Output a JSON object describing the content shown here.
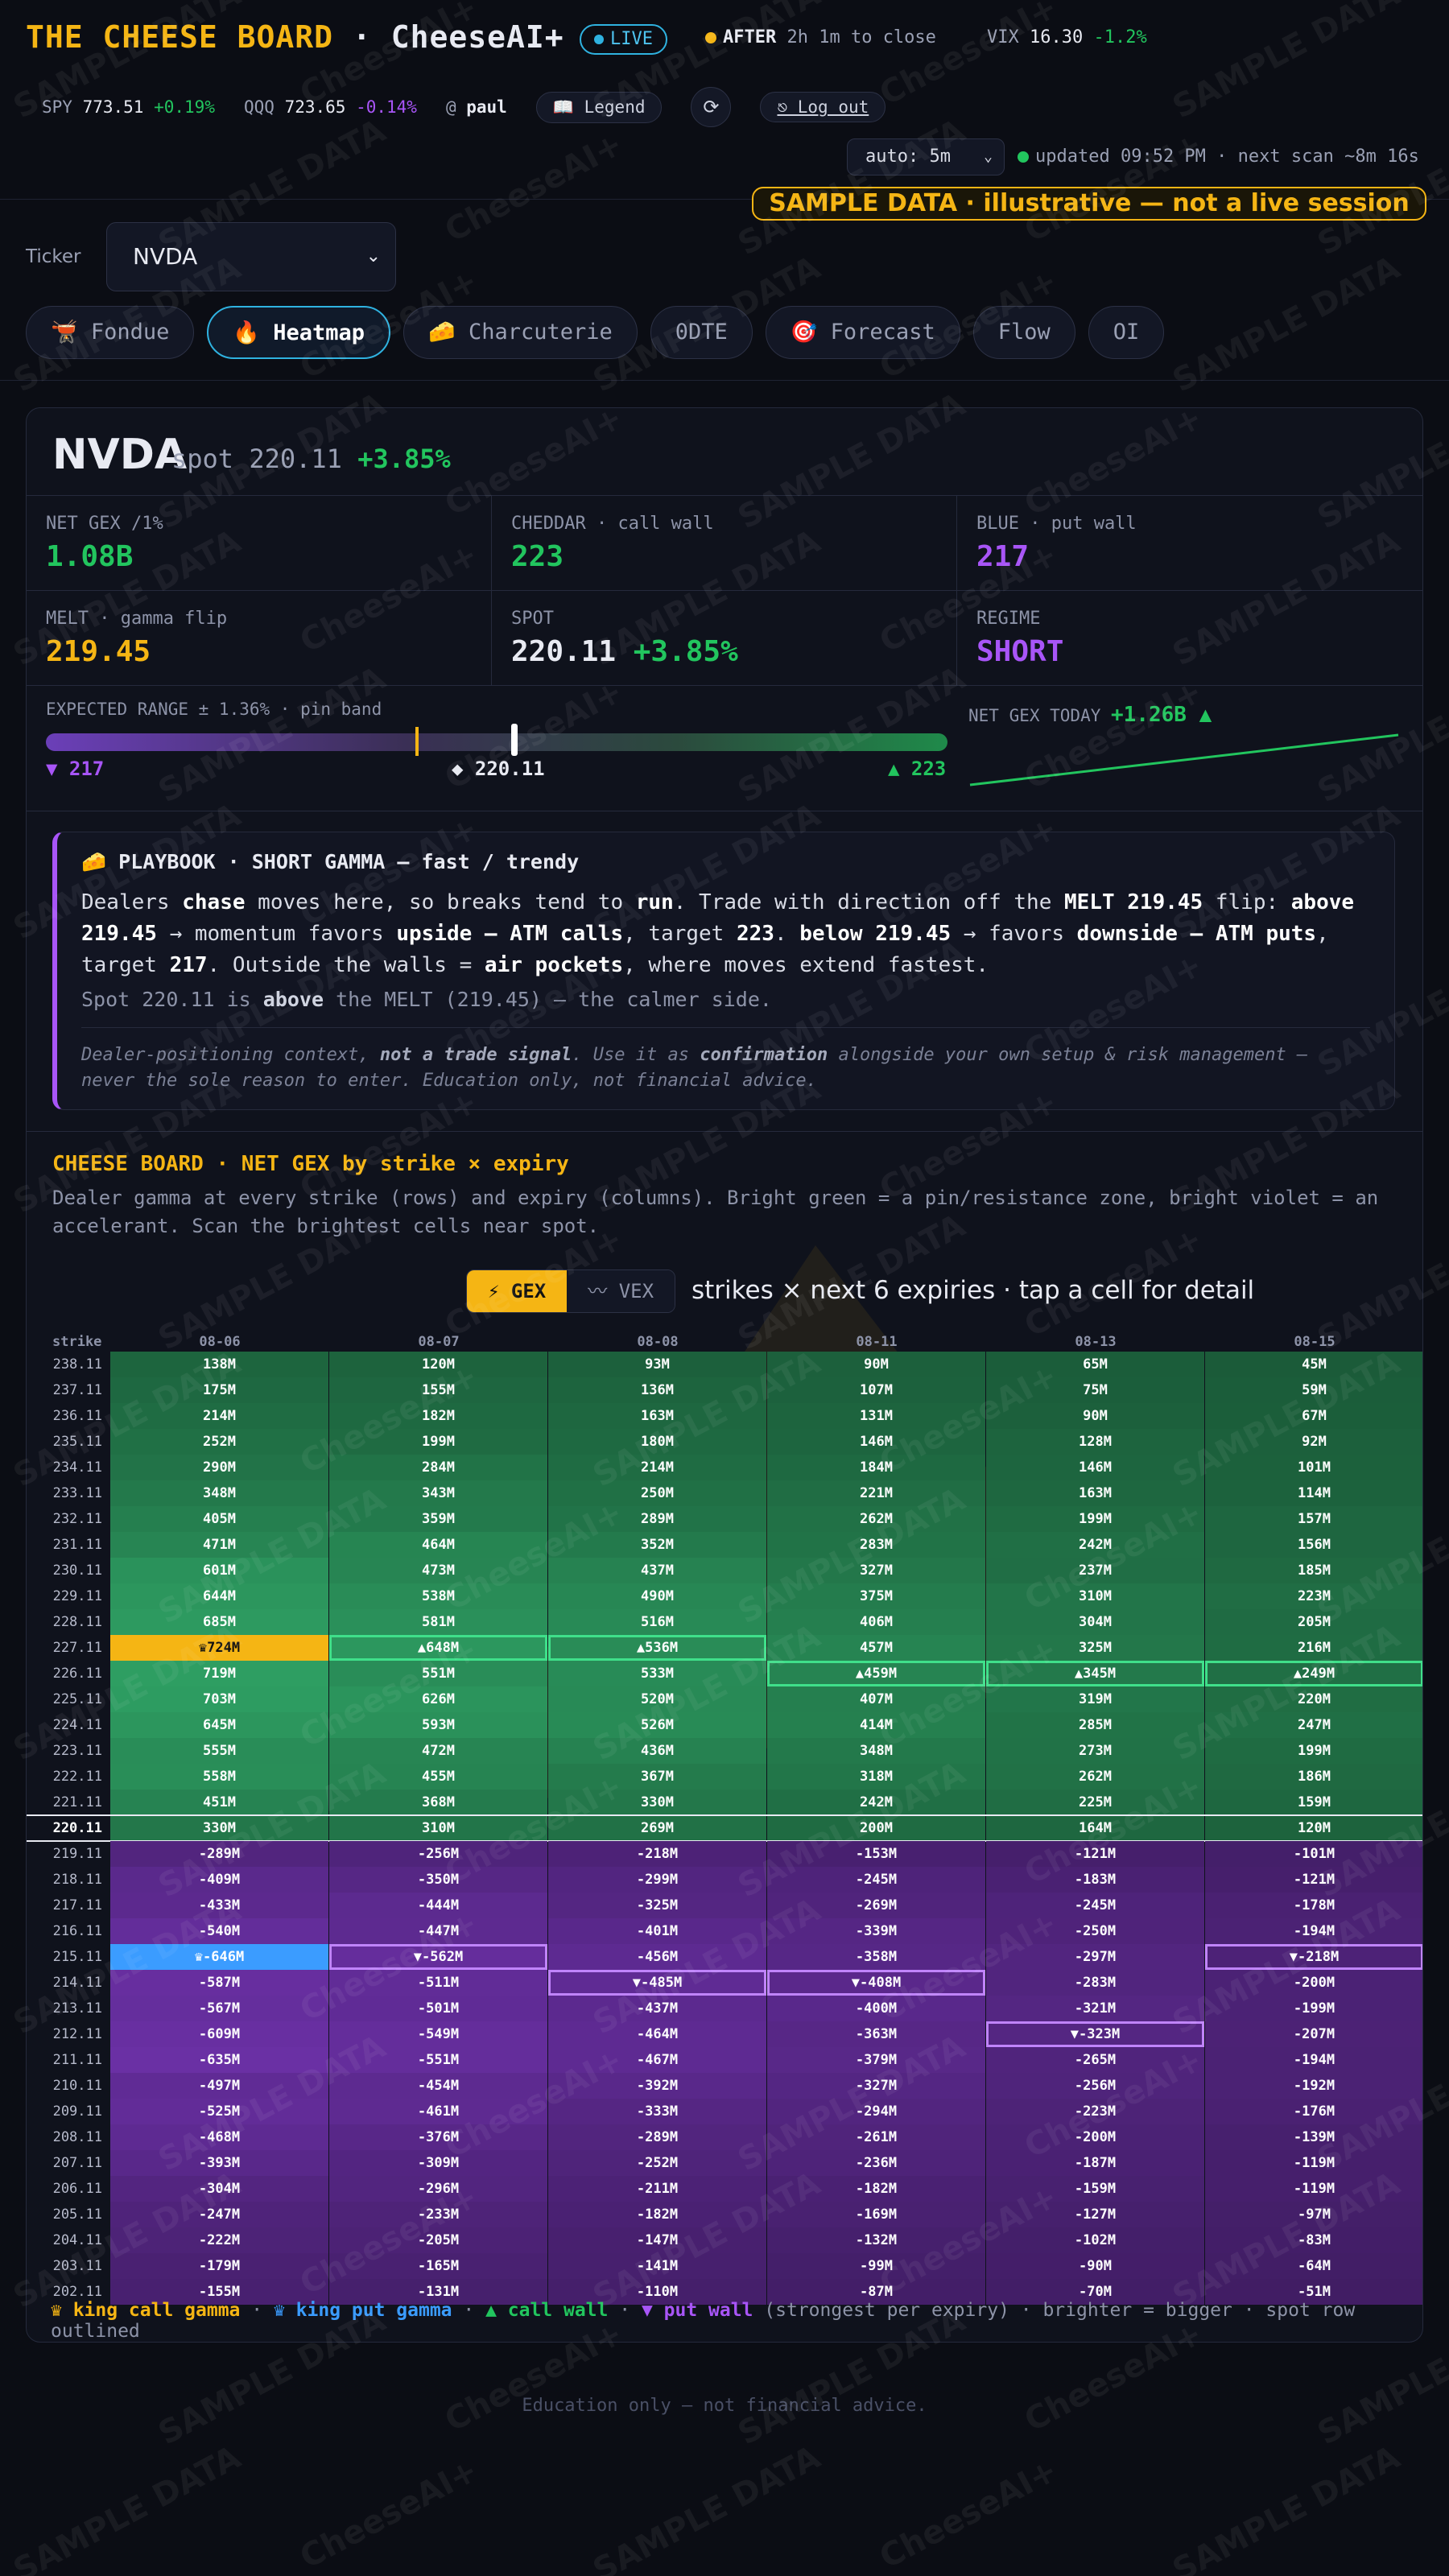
{
  "header": {
    "brand": "THE CHEESE BOARD",
    "brand_sep": " · ",
    "brand_product": "CheeseAI+",
    "live_label": "LIVE",
    "after_label": "AFTER",
    "after_text": "2h 1m to close",
    "vix_label": "VIX",
    "vix_value": "16.30",
    "vix_change": "-1.2%",
    "spy_label": "SPY",
    "spy_value": "773.51",
    "spy_change": "+0.19%",
    "qqq_label": "QQQ",
    "qqq_value": "723.65",
    "qqq_change": "-0.14%",
    "user_prefix": "@",
    "user_name": "paul",
    "legend_button": "📖 Legend",
    "refresh_icon": "⟳",
    "logout_button": "⎋ Log out",
    "auto_select": "auto: 5m",
    "updated_text": "updated 09:52 PM · next scan ~8m 16s",
    "sample_banner": "SAMPLE DATA · illustrative — not a live session"
  },
  "ticker": {
    "label": "Ticker",
    "value": "NVDA"
  },
  "tabs": [
    {
      "label": "🫕 Fondue"
    },
    {
      "label": "🔥 Heatmap"
    },
    {
      "label": "🧀 Charcuterie"
    },
    {
      "label": "0DTE"
    },
    {
      "label": "🎯 Forecast"
    },
    {
      "label": "Flow"
    },
    {
      "label": "OI"
    }
  ],
  "summary": {
    "symbol": "NVDA",
    "spot_label": "spot",
    "spot": "220.11",
    "spot_change": "+3.85%",
    "cells": [
      {
        "label": "NET GEX /1%",
        "value": "1.08B",
        "color": "#22c55e"
      },
      {
        "label": "CHEDDAR · call wall",
        "value": "223",
        "color": "#22c55e"
      },
      {
        "label": "BLUE · put wall",
        "value": "217",
        "color": "#a855f7"
      },
      {
        "label": "MELT · gamma flip",
        "value": "219.45",
        "color": "#f5b514"
      },
      {
        "label": "SPOT",
        "value": "220.11",
        "value2": "+3.85%",
        "color": "#e8eaf2"
      },
      {
        "label": "REGIME",
        "value": "SHORT",
        "color": "#a855f7"
      }
    ],
    "range_label": "EXPECTED RANGE ± 1.36% · pin band",
    "range_low": "▼ 217",
    "range_mid": "◆ 220.11",
    "range_high": "▲ 223",
    "range_pin_frac": 0.41,
    "range_spot_frac": 0.52,
    "netgex_today_label": "NET GEX TODAY",
    "netgex_today_value": "+1.26B ▲"
  },
  "playbook": {
    "title": "🧀 PLAYBOOK · SHORT GAMMA — fast / trendy",
    "line1_a": "Dealers ",
    "line1_b": "chase",
    "line1_c": " moves here, so breaks tend to ",
    "line1_d": "run",
    "line1_e": ". Trade with direction off the ",
    "line1_f": "MELT 219.45",
    "line1_g": " flip: ",
    "line1_h": "above 219.45",
    "line1_i": " → momentum favors ",
    "line1_j": "upside — ATM calls",
    "line1_k": ", target ",
    "line1_l": "223",
    "line1_m": ". ",
    "line1_n": "below 219.45",
    "line1_o": " → favors ",
    "line1_p": "downside — ATM puts",
    "line1_q": ", target ",
    "line1_r": "217",
    "line1_s": ". Outside the walls = ",
    "line1_t": "air pockets",
    "line1_u": ", where moves extend fastest.",
    "note_a": "Spot 220.11 is ",
    "note_b": "above",
    "note_c": " the MELT (219.45) — the calmer side.",
    "disc_a": "Dealer-positioning context, ",
    "disc_b": "not a trade signal",
    "disc_c": ". Use it as ",
    "disc_d": "confirmation",
    "disc_e": " alongside your own setup & risk management — never the sole reason to enter. Education only, not financial advice."
  },
  "heatmap": {
    "title": "CHEESE BOARD · NET GEX by strike × expiry",
    "description": "Dealer gamma at every strike (rows) and expiry (columns). Bright green = a pin/resistance zone, bright violet = an accelerant. Scan the brightest cells near spot.",
    "toggle_gex": "⚡ GEX",
    "toggle_vex": "〰 VEX",
    "caption": "strikes × next 6 expiries · tap a cell for detail",
    "strike_header": "strike",
    "expiries": [
      "08-06",
      "08-07",
      "08-08",
      "08-11",
      "08-13",
      "08-15"
    ],
    "spot_strike": "220.11",
    "rows": [
      {
        "strike": "238.11",
        "values": [
          138,
          120,
          93,
          90,
          65,
          45
        ]
      },
      {
        "strike": "237.11",
        "values": [
          175,
          155,
          136,
          107,
          75,
          59
        ]
      },
      {
        "strike": "236.11",
        "values": [
          214,
          182,
          163,
          131,
          90,
          67
        ]
      },
      {
        "strike": "235.11",
        "values": [
          252,
          199,
          180,
          146,
          128,
          92
        ]
      },
      {
        "strike": "234.11",
        "values": [
          290,
          284,
          214,
          184,
          146,
          101
        ]
      },
      {
        "strike": "233.11",
        "values": [
          348,
          343,
          250,
          221,
          163,
          114
        ]
      },
      {
        "strike": "232.11",
        "values": [
          405,
          359,
          289,
          262,
          199,
          157
        ]
      },
      {
        "strike": "231.11",
        "values": [
          471,
          464,
          352,
          283,
          242,
          156
        ]
      },
      {
        "strike": "230.11",
        "values": [
          601,
          473,
          437,
          327,
          237,
          185
        ]
      },
      {
        "strike": "229.11",
        "values": [
          644,
          538,
          490,
          375,
          310,
          223
        ]
      },
      {
        "strike": "228.11",
        "values": [
          685,
          581,
          516,
          406,
          304,
          205
        ]
      },
      {
        "strike": "227.11",
        "values": [
          724,
          648,
          536,
          457,
          325,
          216
        ]
      },
      {
        "strike": "226.11",
        "values": [
          719,
          551,
          533,
          459,
          345,
          249
        ]
      },
      {
        "strike": "225.11",
        "values": [
          703,
          626,
          520,
          407,
          319,
          220
        ]
      },
      {
        "strike": "224.11",
        "values": [
          645,
          593,
          526,
          414,
          285,
          247
        ]
      },
      {
        "strike": "223.11",
        "values": [
          555,
          472,
          436,
          348,
          273,
          199
        ]
      },
      {
        "strike": "222.11",
        "values": [
          558,
          455,
          367,
          318,
          262,
          186
        ]
      },
      {
        "strike": "221.11",
        "values": [
          451,
          368,
          330,
          242,
          225,
          159
        ]
      },
      {
        "strike": "220.11",
        "values": [
          330,
          310,
          269,
          200,
          164,
          120
        ]
      },
      {
        "strike": "219.11",
        "values": [
          -289,
          -256,
          -218,
          -153,
          -121,
          -101
        ]
      },
      {
        "strike": "218.11",
        "values": [
          -409,
          -350,
          -299,
          -245,
          -183,
          -121
        ]
      },
      {
        "strike": "217.11",
        "values": [
          -433,
          -444,
          -325,
          -269,
          -245,
          -178
        ]
      },
      {
        "strike": "216.11",
        "values": [
          -540,
          -447,
          -401,
          -339,
          -250,
          -194
        ]
      },
      {
        "strike": "215.11",
        "values": [
          -646,
          -562,
          -456,
          -358,
          -297,
          -218
        ]
      },
      {
        "strike": "214.11",
        "values": [
          -587,
          -511,
          -485,
          -408,
          -283,
          -200
        ]
      },
      {
        "strike": "213.11",
        "values": [
          -567,
          -501,
          -437,
          -400,
          -321,
          -199
        ]
      },
      {
        "strike": "212.11",
        "values": [
          -609,
          -549,
          -464,
          -363,
          -323,
          -207
        ]
      },
      {
        "strike": "211.11",
        "values": [
          -635,
          -551,
          -467,
          -379,
          -265,
          -194
        ]
      },
      {
        "strike": "210.11",
        "values": [
          -497,
          -454,
          -392,
          -327,
          -256,
          -192
        ]
      },
      {
        "strike": "209.11",
        "values": [
          -525,
          -461,
          -333,
          -294,
          -223,
          -176
        ]
      },
      {
        "strike": "208.11",
        "values": [
          -468,
          -376,
          -289,
          -261,
          -200,
          -139
        ]
      },
      {
        "strike": "207.11",
        "values": [
          -393,
          -309,
          -252,
          -236,
          -187,
          -119
        ]
      },
      {
        "strike": "206.11",
        "values": [
          -304,
          -296,
          -211,
          -182,
          -159,
          -119
        ]
      },
      {
        "strike": "205.11",
        "values": [
          -247,
          -233,
          -182,
          -169,
          -127,
          -97
        ]
      },
      {
        "strike": "204.11",
        "values": [
          -222,
          -205,
          -147,
          -132,
          -102,
          -83
        ]
      },
      {
        "strike": "203.11",
        "values": [
          -179,
          -165,
          -141,
          -99,
          -90,
          -64
        ]
      },
      {
        "strike": "202.11",
        "values": [
          -155,
          -131,
          -110,
          -87,
          -70,
          -51
        ]
      }
    ],
    "king_call": {
      "strike": "227.11",
      "col": 0
    },
    "king_put": {
      "strike": "215.11",
      "col": 0
    },
    "call_walls": [
      {
        "strike": "227.11",
        "col": 1
      },
      {
        "strike": "227.11",
        "col": 2
      },
      {
        "strike": "226.11",
        "col": 3
      },
      {
        "strike": "226.11",
        "col": 4
      },
      {
        "strike": "226.11",
        "col": 5
      }
    ],
    "put_walls": [
      {
        "strike": "215.11",
        "col": 1
      },
      {
        "strike": "214.11",
        "col": 2
      },
      {
        "strike": "214.11",
        "col": 3
      },
      {
        "strike": "212.11",
        "col": 4
      },
      {
        "strike": "215.11",
        "col": 5
      }
    ],
    "unit_suffix": "M",
    "king_call_mark": "♛",
    "king_put_mark": "♛",
    "call_wall_mark": "▲",
    "put_wall_mark": "▼"
  },
  "legend": {
    "king_call": "♛ king call gamma",
    "king_put": "♛ king put gamma",
    "call_wall": "▲ call wall",
    "put_wall": "▼ put wall",
    "dot": " · ",
    "rest": "(strongest per expiry) · brighter = bigger · spot row outlined"
  },
  "footer": "Education only — not financial advice.",
  "watermarks": [
    "SAMPLE DATA",
    "CheeseAI+"
  ],
  "colors": {
    "brand": "#f5b514",
    "call": "#22c55e",
    "put": "#a855f7",
    "live": "#2fb2e0",
    "king_put": "#3b9cff"
  }
}
